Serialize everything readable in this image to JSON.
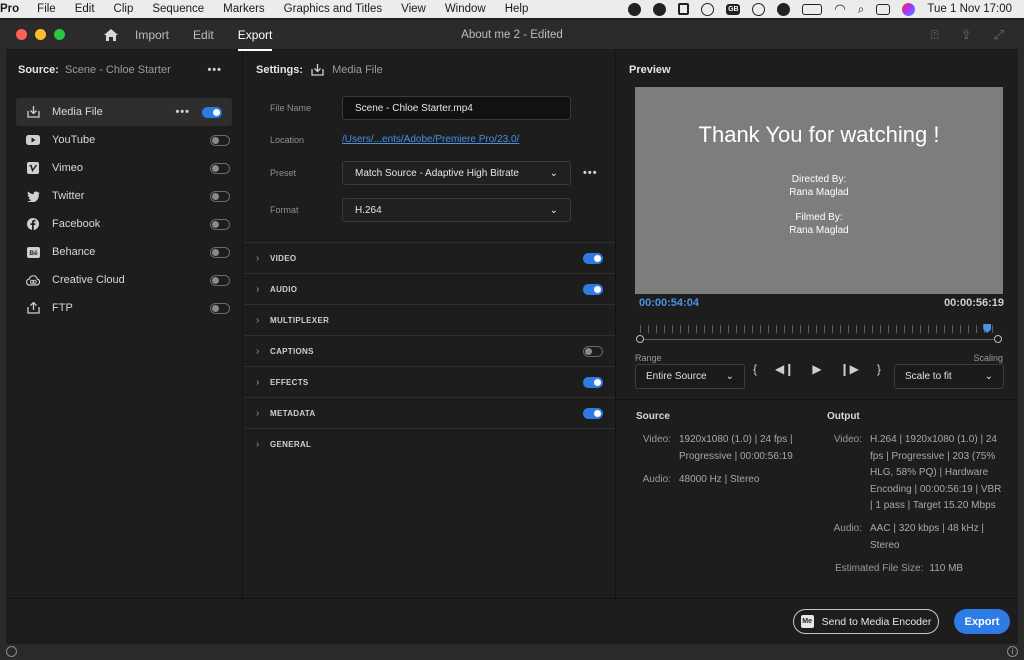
{
  "menubar": {
    "app": "Pro",
    "items": [
      "File",
      "Edit",
      "Clip",
      "Sequence",
      "Markers",
      "Graphics and Titles",
      "View",
      "Window",
      "Help"
    ],
    "status_icons": [
      "app-icon",
      "creative-cloud-icon",
      "script-icon",
      "play-circle-icon",
      "gb-badge-icon",
      "info-circle-icon",
      "shazam-icon",
      "battery-icon",
      "wifi-icon",
      "spotlight-search-icon",
      "control-center-icon",
      "siri-icon"
    ],
    "gb_badge": "GB",
    "clock": "Tue 1 Nov  17:00"
  },
  "window": {
    "title": "About me 2 - Edited",
    "tabs": [
      "Import",
      "Edit",
      "Export"
    ],
    "active_tab": "Export"
  },
  "source_panel": {
    "label": "Source:",
    "value": "Scene - Chloe Starter",
    "more": "•••",
    "destinations": [
      {
        "label": "Media File",
        "icon": "download-tray-icon",
        "on": true,
        "selected": true
      },
      {
        "label": "YouTube",
        "icon": "youtube-icon",
        "on": false
      },
      {
        "label": "Vimeo",
        "icon": "vimeo-icon",
        "on": false
      },
      {
        "label": "Twitter",
        "icon": "twitter-icon",
        "on": false
      },
      {
        "label": "Facebook",
        "icon": "facebook-icon",
        "on": false
      },
      {
        "label": "Behance",
        "icon": "behance-icon",
        "on": false
      },
      {
        "label": "Creative Cloud",
        "icon": "creative-cloud-icon",
        "on": false
      },
      {
        "label": "FTP",
        "icon": "upload-icon",
        "on": false
      }
    ]
  },
  "settings_panel": {
    "label": "Settings:",
    "target": "Media File",
    "file_name_label": "File Name",
    "file_name": "Scene - Chloe Starter.mp4",
    "location_label": "Location",
    "location": "/Users/...ents/Adobe/Premiere Pro/23.0/",
    "preset_label": "Preset",
    "preset": "Match Source - Adaptive High Bitrate",
    "preset_more": "•••",
    "format_label": "Format",
    "format": "H.264",
    "sections": [
      {
        "label": "VIDEO",
        "toggle": true,
        "on": true
      },
      {
        "label": "AUDIO",
        "toggle": true,
        "on": true
      },
      {
        "label": "MULTIPLEXER",
        "toggle": false
      },
      {
        "label": "CAPTIONS",
        "toggle": true,
        "on": false
      },
      {
        "label": "EFFECTS",
        "toggle": true,
        "on": true
      },
      {
        "label": "METADATA",
        "toggle": true,
        "on": true
      },
      {
        "label": "GENERAL",
        "toggle": false
      }
    ]
  },
  "preview_panel": {
    "label": "Preview",
    "frame": {
      "title": "Thank You for watching !",
      "directed_label": "Directed By:",
      "directed_name": "Rana Maglad",
      "filmed_label": "Filmed By:",
      "filmed_name": "Rana Maglad"
    },
    "current_time": "00:00:54:04",
    "duration": "00:00:56:19",
    "playhead_fraction": 0.97,
    "range_label": "Range",
    "range_value": "Entire Source",
    "scaling_label": "Scaling",
    "scaling_value": "Scale to fit"
  },
  "summary": {
    "source_label": "Source",
    "output_label": "Output",
    "source_video_label": "Video:",
    "source_video": [
      "1920x1080 (1.0)  |  24 fps  |",
      "Progressive  |  00:00:56:19"
    ],
    "source_audio_label": "Audio:",
    "source_audio": [
      "48000 Hz  |  Stereo"
    ],
    "output_video_label": "Video:",
    "output_video": [
      "H.264  |  1920x1080 (1.0)  |  24",
      "fps  |  Progressive  |  203 (75%",
      "HLG, 58% PQ)  |  Hardware",
      "Encoding  |  00:00:56:19  |  VBR",
      "|  1 pass  |  Target 15.20 Mbps"
    ],
    "output_audio_label": "Audio:",
    "output_audio": [
      "AAC  |  320 kbps  |  48 kHz  |",
      "Stereo"
    ],
    "est_label": "Estimated File Size:",
    "est_value": "110 MB"
  },
  "footer": {
    "encoder_badge": "Me",
    "send_label": "Send to Media Encoder",
    "export_label": "Export"
  },
  "colors": {
    "accent": "#2d7be3",
    "timecode": "#4b92e8"
  }
}
